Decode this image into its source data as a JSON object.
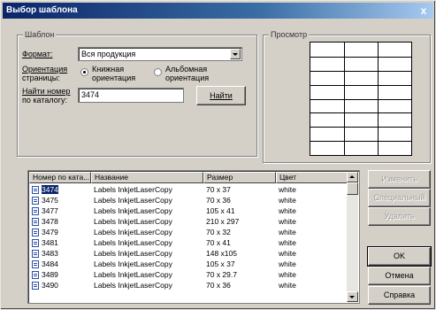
{
  "window": {
    "title": "Выбор шаблона",
    "close_glyph": "x"
  },
  "template_group": {
    "title": "Шаблон",
    "format_label": "Формат:",
    "format_value": "Вся продукция",
    "orientation_label_line1": "Ориентация",
    "orientation_label_line2": "страницы:",
    "orientation_options": [
      {
        "label_line1": "Книжная",
        "label_line2": "ориентация",
        "selected": true
      },
      {
        "label_line1": "Альбомная",
        "label_line2": "ориентация",
        "selected": false
      }
    ],
    "find_label_line1": "Найти номер",
    "find_label_line2": "по каталогу:",
    "find_value": "3474",
    "find_button": "Найти"
  },
  "preview_group": {
    "title": "Просмотр",
    "grid_columns": 3,
    "grid_rows": 8
  },
  "list": {
    "headers": [
      "Номер по ката...",
      "Название",
      "Размер",
      "Цвет"
    ],
    "rows": [
      {
        "num": "3474",
        "name": "Labels InkjetLaserCopy",
        "size": "70 x 37",
        "color": "white",
        "selected": true
      },
      {
        "num": "3475",
        "name": "Labels InkjetLaserCopy",
        "size": "70 x 36",
        "color": "white"
      },
      {
        "num": "3477",
        "name": "Labels InkjetLaserCopy",
        "size": "105 x 41",
        "color": "white"
      },
      {
        "num": "3478",
        "name": "Labels InkjetLaserCopy",
        "size": "210 x 297",
        "color": "white"
      },
      {
        "num": "3479",
        "name": "Labels InkjetLaserCopy",
        "size": "70 x 32",
        "color": "white"
      },
      {
        "num": "3481",
        "name": "Labels InkjetLaserCopy",
        "size": "70 x 41",
        "color": "white"
      },
      {
        "num": "3483",
        "name": "Labels InkjetLaserCopy",
        "size": "148 x105",
        "color": "white"
      },
      {
        "num": "3484",
        "name": "Labels InkjetLaserCopy",
        "size": "105 x 37",
        "color": "white"
      },
      {
        "num": "3489",
        "name": "Labels InkjetLaserCopy",
        "size": "70 x 29.7",
        "color": "white"
      },
      {
        "num": "3490",
        "name": "Labels InkjetLaserCopy",
        "size": "70 x 36",
        "color": "white"
      }
    ]
  },
  "side_buttons": {
    "edit": "Изменить",
    "special": "Специальный",
    "delete": "Удалить",
    "ok": "OK",
    "cancel": "Отмена",
    "help": "Справка"
  },
  "colors": {
    "title_bar": "#0a246a",
    "selection": "#0a246a",
    "face": "#d4d0c8"
  }
}
